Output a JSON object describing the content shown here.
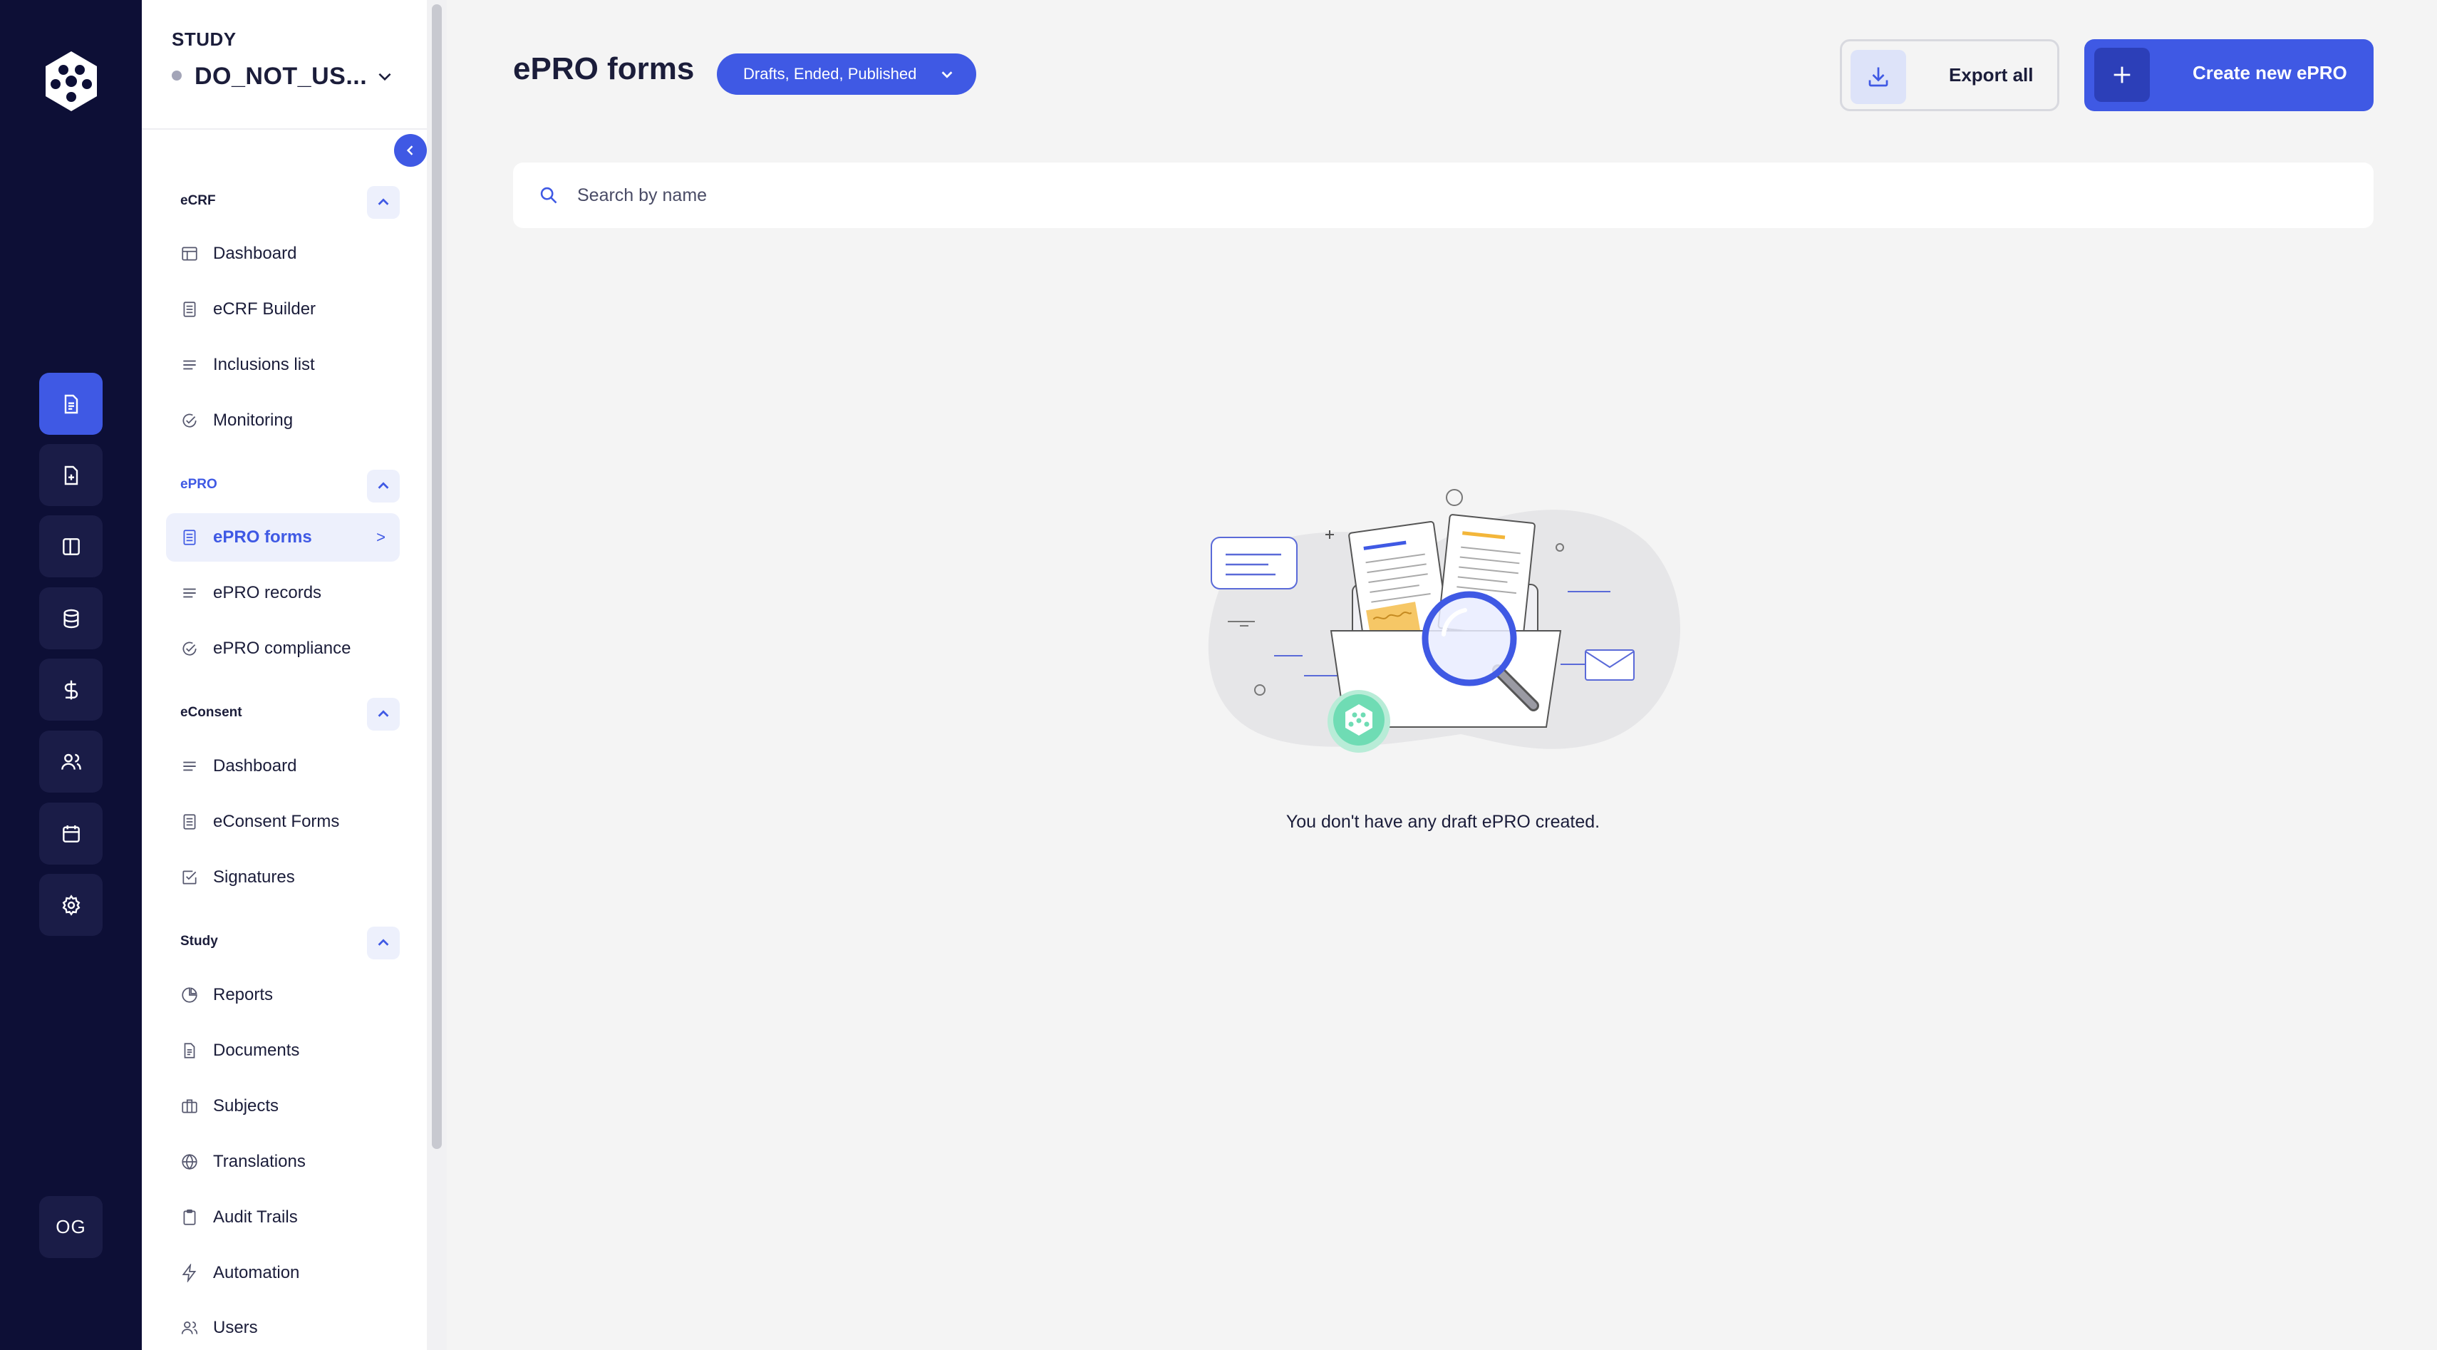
{
  "rail": {
    "items": [
      {
        "name": "epro-forms",
        "icon": "document-icon",
        "active": true
      },
      {
        "name": "add-document",
        "icon": "document-plus-icon",
        "active": false
      },
      {
        "name": "layout",
        "icon": "columns-icon",
        "active": false
      },
      {
        "name": "database",
        "icon": "database-icon",
        "active": false
      },
      {
        "name": "payments",
        "icon": "dollar-icon",
        "active": false
      },
      {
        "name": "users",
        "icon": "users-icon",
        "active": false
      },
      {
        "name": "calendar",
        "icon": "calendar-icon",
        "active": false
      },
      {
        "name": "settings",
        "icon": "gear-icon",
        "active": false
      }
    ],
    "avatar_initials": "OG"
  },
  "study": {
    "label": "STUDY",
    "name": "DO_NOT_US..."
  },
  "sections": {
    "ecrf": {
      "title": "eCRF",
      "items": [
        "Dashboard",
        "eCRF Builder",
        "Inclusions list",
        "Monitoring"
      ]
    },
    "epro": {
      "title": "ePRO",
      "items": [
        "ePRO forms",
        "ePRO records",
        "ePRO compliance"
      ],
      "active_arrow": ">"
    },
    "econsent": {
      "title": "eConsent",
      "items": [
        "Dashboard",
        "eConsent Forms",
        "Signatures"
      ]
    },
    "study": {
      "title": "Study",
      "items": [
        "Reports",
        "Documents",
        "Subjects",
        "Translations",
        "Audit Trails",
        "Automation",
        "Users"
      ]
    }
  },
  "header": {
    "title": "ePRO forms",
    "filter": "Drafts, Ended, Published",
    "export_label": "Export all",
    "create_label": "Create new ePRO"
  },
  "search": {
    "placeholder": "Search by name",
    "value": ""
  },
  "empty_state": {
    "message": "You don't have any draft ePRO created."
  },
  "colors": {
    "accent": "#3f59e4",
    "rail_bg": "#0d0f36",
    "page_bg": "#f4f4f4",
    "logo_green": "#6fdcb4"
  }
}
